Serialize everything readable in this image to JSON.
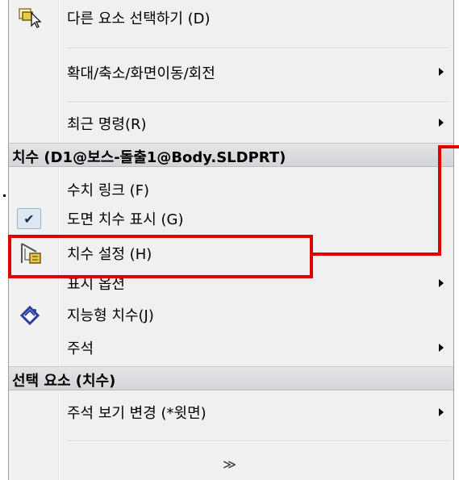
{
  "menu": {
    "items_top": [
      {
        "label": "다른 요소 선택하기 (D)",
        "icon": "select-other-icon",
        "submenu": false
      },
      {
        "label": "확대/축소/화면이동/회전",
        "submenu": true
      },
      {
        "label": "최근 명령(R)",
        "submenu": true
      }
    ],
    "header1": "치수 (D1@보스-돌출1@Body.SLDPRT)",
    "items_mid": [
      {
        "label": "수치 링크 (F)",
        "submenu": false
      },
      {
        "label": "도면 치수 표시 (G)",
        "icon": "checkmark-icon",
        "check": "✔",
        "submenu": false
      },
      {
        "label": "치수 설정 (H)",
        "icon": "dimension-settings-icon",
        "submenu": false
      },
      {
        "label": "표시 옵션",
        "submenu": true
      },
      {
        "label": "지능형 치수(J)",
        "icon": "smart-dimension-icon",
        "submenu": false
      },
      {
        "label": "주석",
        "submenu": true
      }
    ],
    "header2": "선택 요소 (치수)",
    "items_bottom": [
      {
        "label": "주석 보기 변경 (*윗면)",
        "submenu": true
      }
    ],
    "expand_glyph": "≫"
  },
  "colors": {
    "highlight": "#e00000",
    "menu_bg": "#f0f0f0",
    "header_bg": "#d7d9dc"
  }
}
